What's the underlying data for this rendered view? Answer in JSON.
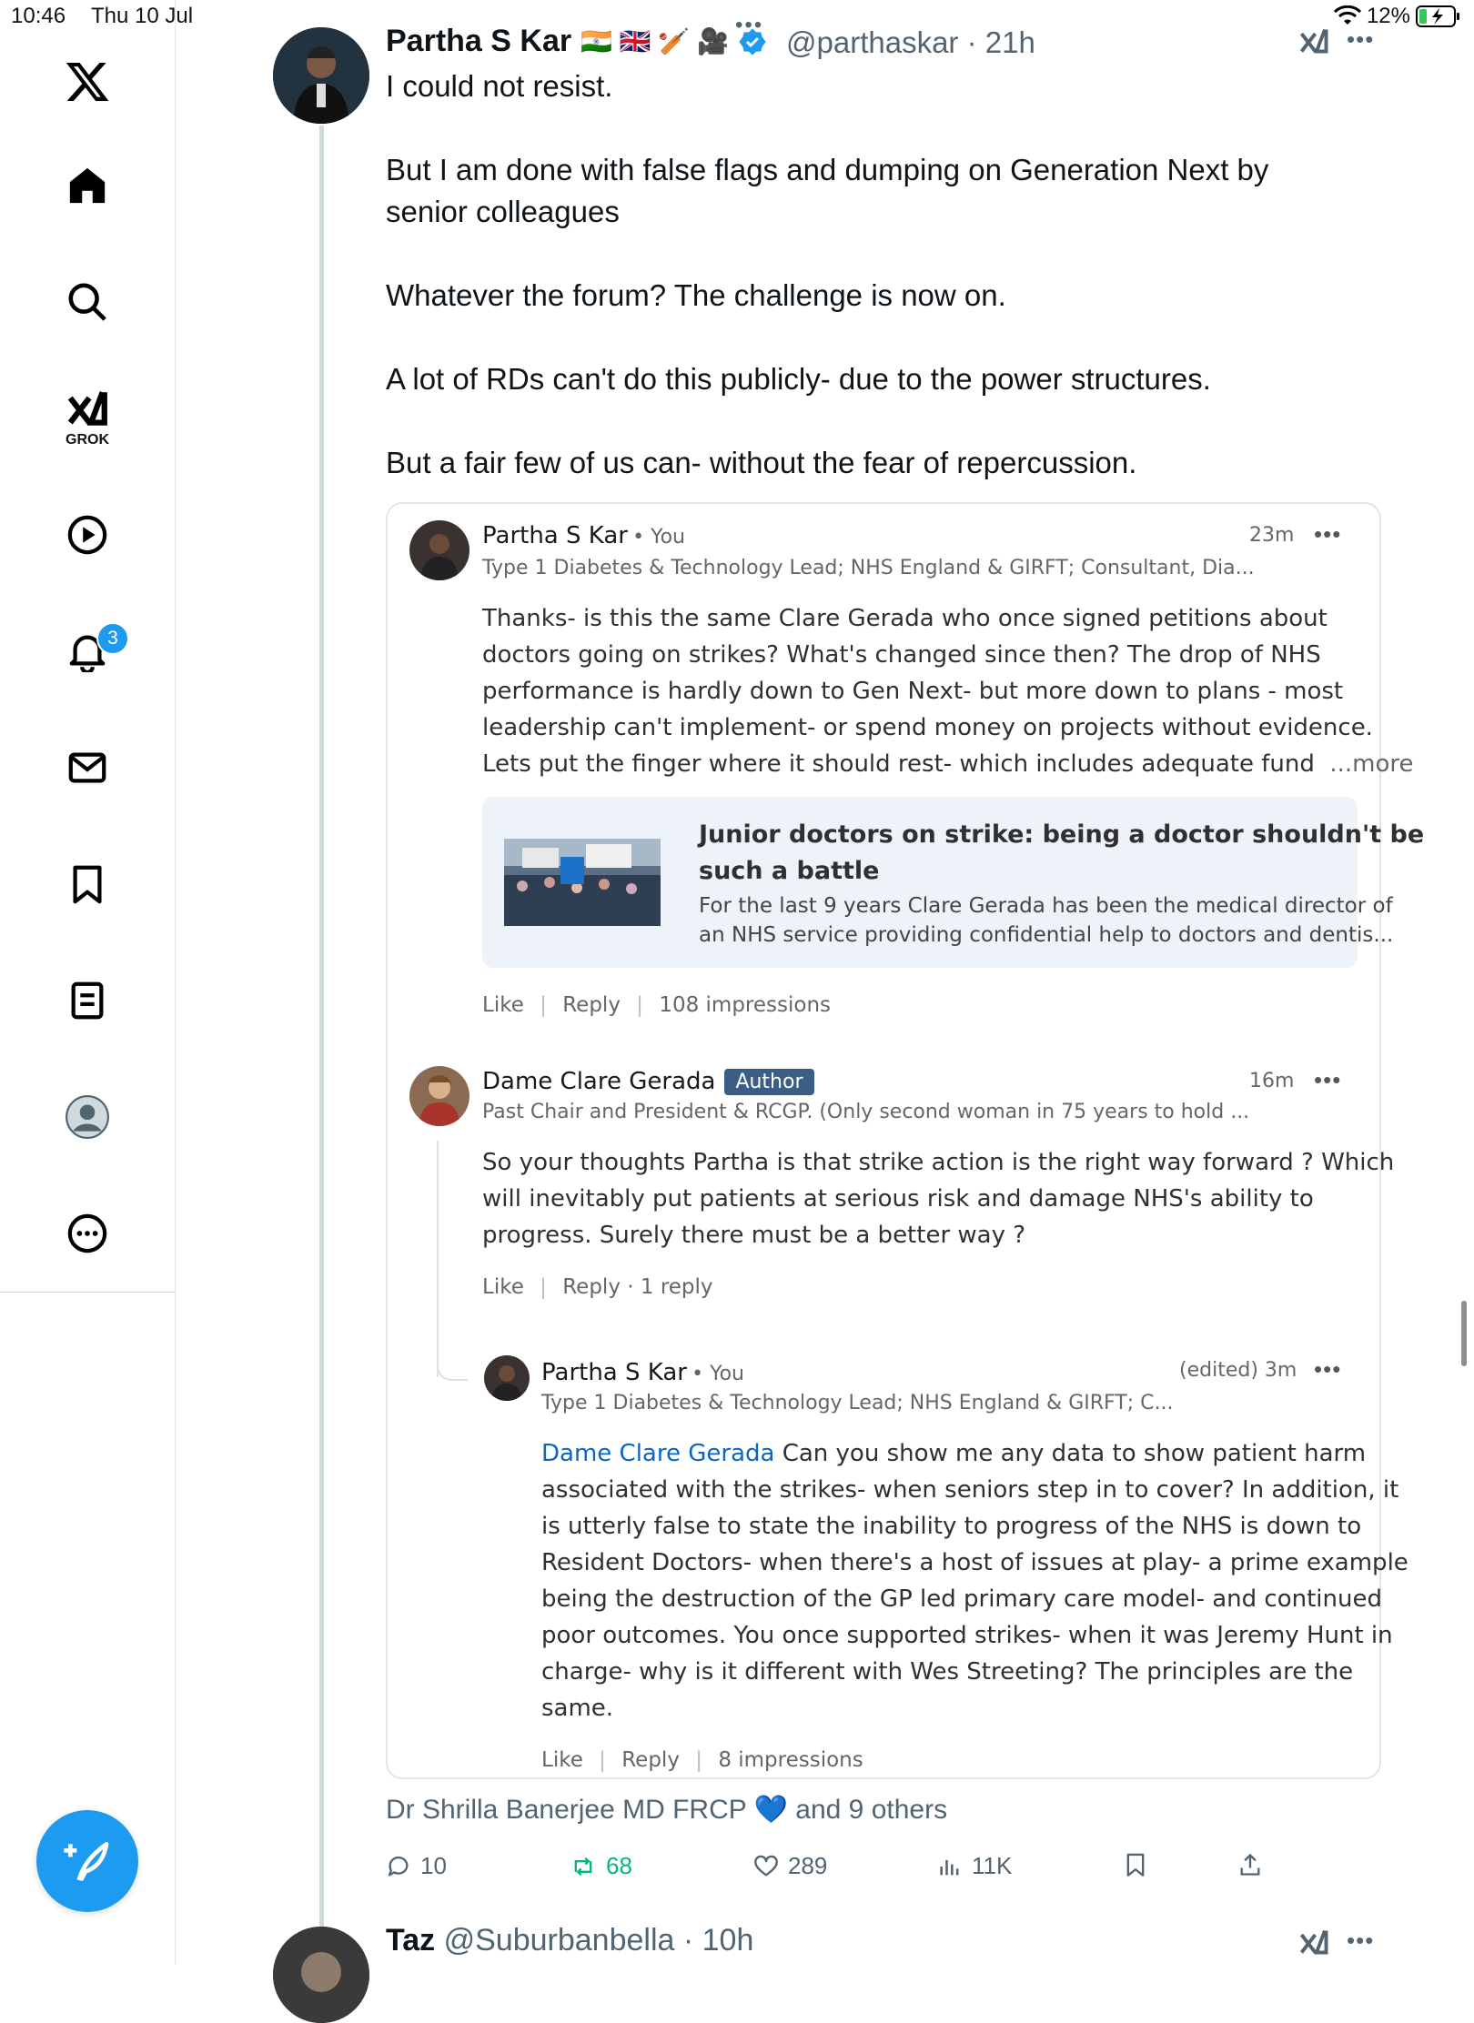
{
  "status_bar": {
    "time": "10:46",
    "date": "Thu 10 Jul",
    "battery": "12%"
  },
  "sidebar": {
    "items": [
      {
        "name": "x-logo"
      },
      {
        "name": "home"
      },
      {
        "name": "search"
      },
      {
        "name": "grok",
        "label": "GROK"
      },
      {
        "name": "video"
      },
      {
        "name": "notifications",
        "badge": "3"
      },
      {
        "name": "messages"
      },
      {
        "name": "bookmarks"
      },
      {
        "name": "lists"
      },
      {
        "name": "profile"
      },
      {
        "name": "more"
      }
    ]
  },
  "tweet": {
    "author_name": "Partha S Kar",
    "author_emoji": "🇮🇳 🇬🇧 🏏 🎥",
    "handle": "@parthaskar",
    "time": "· 21h",
    "lines": [
      "I could not resist.",
      "But I am done with false flags and dumping on Generation Next by",
      "senior colleagues",
      "Whatever the forum? The challenge is now on.",
      "A lot of RDs can't do this publicly- due to the power structures.",
      "But a fair few of us can- without the fear of repercussion."
    ],
    "liked_by": "Dr Shrilla Banerjee MD FRCP",
    "liked_by_others": "and 9 others",
    "stats": {
      "replies": "10",
      "reposts": "68",
      "likes": "289",
      "views": "11K"
    }
  },
  "embedded": {
    "comment1": {
      "name": "Partha S Kar",
      "you": "• You",
      "subtitle": "Type 1 Diabetes & Technology Lead; NHS England & GIRFT; Consultant, Dia...",
      "time": "23m",
      "body": [
        "Thanks- is this the same Clare Gerada who once signed petitions about",
        "doctors going on strikes? What's changed since then? The drop of NHS",
        "performance is hardly down to Gen Next- but more down to plans - most",
        "leadership can't implement- or spend money on projects without evidence.",
        "Lets put the finger where it should rest- which includes adequate fund"
      ],
      "more": "...more",
      "link_title_1": "Junior doctors on strike: being a doctor shouldn't be",
      "link_title_2": "such a battle",
      "link_desc_1": "For the last 9 years Clare Gerada has been the medical director of",
      "link_desc_2": "an NHS service providing confidential help to doctors and dentis...",
      "like": "Like",
      "reply": "Reply",
      "impressions": "108 impressions"
    },
    "comment2": {
      "name": "Dame Clare Gerada",
      "badge": "Author",
      "subtitle": "Past Chair and President & RCGP. (Only second woman in 75 years to hold ...",
      "time": "16m",
      "body": [
        "So your thoughts Partha is that strike action is the right way forward ? Which",
        "will inevitably put patients at serious risk and damage NHS's ability to",
        "progress. Surely there must be a better way ?"
      ],
      "like": "Like",
      "reply": "Reply",
      "replies": "· 1 reply"
    },
    "comment3": {
      "name": "Partha S Kar",
      "you": "• You",
      "subtitle": "Type 1 Diabetes & Technology Lead; NHS England & GIRFT; C...",
      "time": "(edited) 3m",
      "mention": "Dame Clare Gerada",
      "body_first": " Can you show me any data to show patient harm",
      "body": [
        "associated with the strikes- when seniors step in to cover? In addition, it",
        "is utterly false to state the inability to progress of the NHS is down to",
        "Resident Doctors- when there's a host of issues at play- a prime example",
        "being the destruction of the GP led primary care model- and continued",
        "poor outcomes. You once supported strikes- when it was Jeremy Hunt in",
        "charge- why is it different with Wes Streeting? The principles are the",
        "same."
      ],
      "like": "Like",
      "reply": "Reply",
      "impressions": "8 impressions"
    }
  },
  "next_tweet": {
    "author_name": "Taz",
    "handle": "@Suburbanbella",
    "time": "· 10h"
  },
  "colors": {
    "accent": "#1d9bf0",
    "text": "#0f1419",
    "muted": "#536471",
    "repost": "#00ba7c"
  }
}
